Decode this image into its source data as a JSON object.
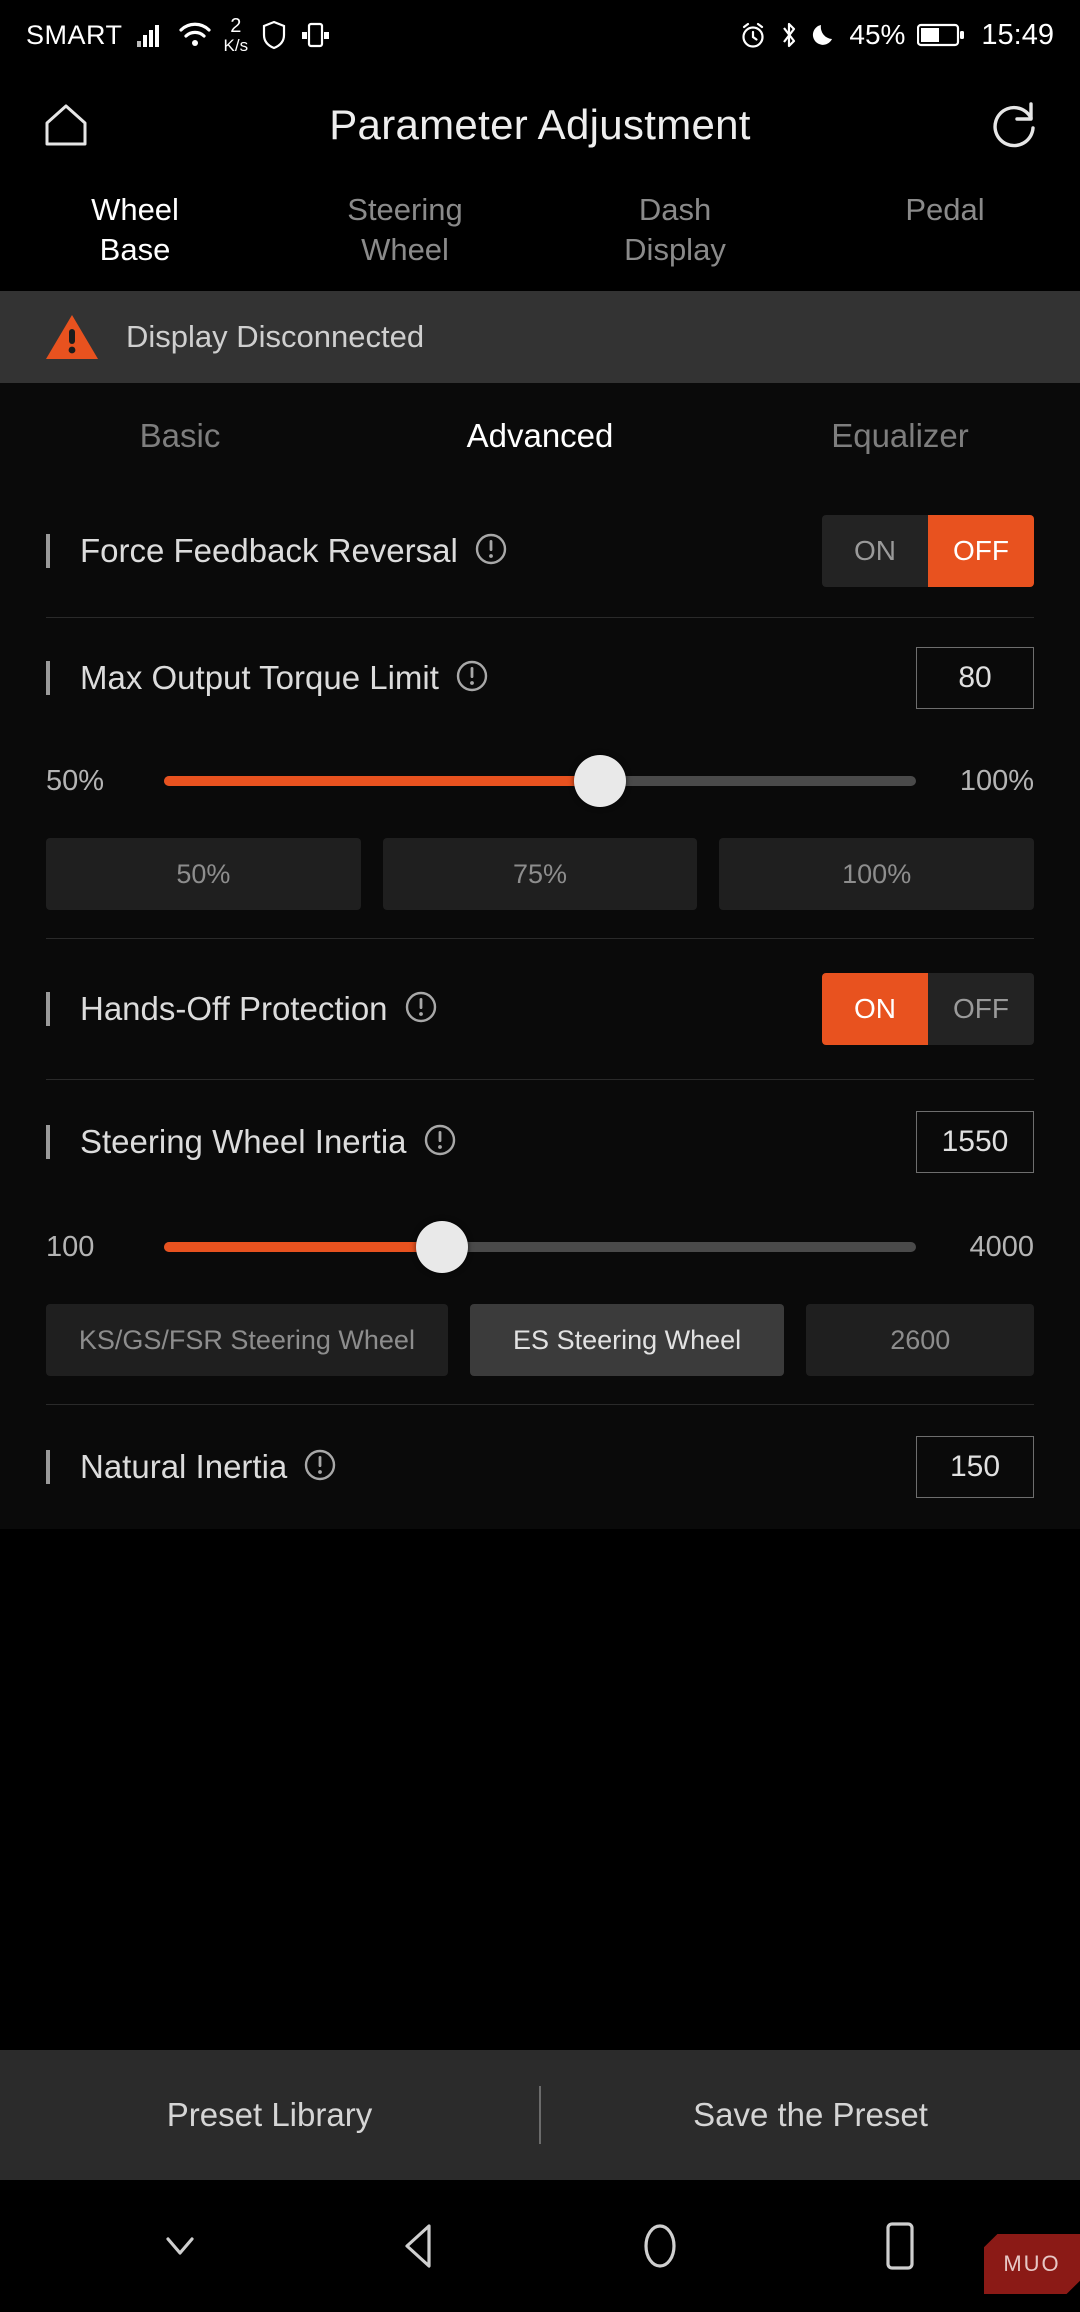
{
  "statusbar": {
    "carrier": "SMART",
    "netspeed_value": "2",
    "netspeed_unit": "K/s",
    "battery_percent": "45%",
    "time": "15:49",
    "icons": [
      "signal-icon",
      "wifi-icon",
      "shield-icon",
      "multi-window-icon",
      "alarm-icon",
      "bluetooth-icon",
      "do-not-disturb-icon",
      "battery-icon"
    ]
  },
  "header": {
    "title": "Parameter Adjustment",
    "home_icon": "home-icon",
    "reset_icon": "reset-icon"
  },
  "main_tabs": [
    {
      "label": "Wheel\nBase",
      "line1": "Wheel",
      "line2": "Base",
      "active": true
    },
    {
      "label": "Steering Wheel",
      "line1": "Steering",
      "line2": "Wheel",
      "active": false
    },
    {
      "label": "Dash Display",
      "line1": "Dash",
      "line2": "Display",
      "active": false
    },
    {
      "label": "Pedal",
      "line1": "Pedal",
      "line2": "",
      "active": false
    }
  ],
  "warning": {
    "text": "Display Disconnected",
    "icon": "warning-triangle-icon",
    "color": "#E8521F"
  },
  "sub_tabs": [
    {
      "label": "Basic",
      "active": false
    },
    {
      "label": "Advanced",
      "active": true
    },
    {
      "label": "Equalizer",
      "active": false
    }
  ],
  "settings": {
    "force_feedback_reversal": {
      "label": "Force Feedback Reversal",
      "info_icon": "info-icon",
      "on_label": "ON",
      "off_label": "OFF",
      "selected": "OFF"
    },
    "max_output_torque_limit": {
      "label": "Max Output Torque Limit",
      "info_icon": "info-icon",
      "value": "80",
      "min_label": "50%",
      "max_label": "100%",
      "fill_percent": 58,
      "presets": [
        {
          "label": "50%",
          "selected": false
        },
        {
          "label": "75%",
          "selected": false
        },
        {
          "label": "100%",
          "selected": false
        }
      ]
    },
    "hands_off_protection": {
      "label": "Hands-Off Protection",
      "info_icon": "info-icon",
      "on_label": "ON",
      "off_label": "OFF",
      "selected": "ON"
    },
    "steering_wheel_inertia": {
      "label": "Steering Wheel Inertia",
      "info_icon": "info-icon",
      "value": "1550",
      "min_label": "100",
      "max_label": "4000",
      "fill_percent": 37,
      "presets": [
        {
          "label": "KS/GS/FSR Steering Wheel",
          "selected": false
        },
        {
          "label": "ES Steering Wheel",
          "selected": true
        },
        {
          "label": "2600",
          "selected": false
        }
      ]
    },
    "natural_inertia": {
      "label": "Natural Inertia",
      "info_icon": "info-icon",
      "value": "150"
    }
  },
  "bottom_bar": {
    "preset_library": "Preset Library",
    "save_preset": "Save the Preset"
  },
  "navbar": {
    "items": [
      "chevron-down-icon",
      "back-icon",
      "home-circle-icon",
      "recents-square-icon"
    ],
    "watermark": "MUO"
  },
  "theme": {
    "accent": "#E8521F",
    "background": "#0a0a0a",
    "banner_bg": "#333333"
  }
}
